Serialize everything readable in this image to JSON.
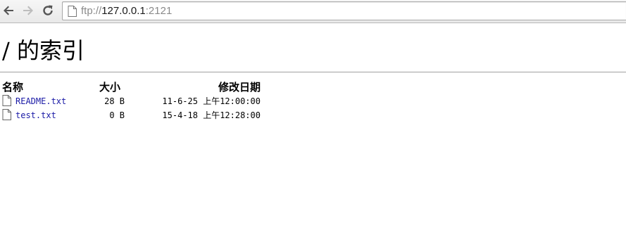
{
  "browser": {
    "url_scheme": "ftp://",
    "url_host": "127.0.0.1",
    "url_port": ":2121"
  },
  "page": {
    "title": "/ 的索引",
    "columns": {
      "name": "名称",
      "size": "大小",
      "date": "修改日期"
    },
    "files": [
      {
        "name": "README.txt",
        "size": "28 B",
        "date": "11-6-25 上午12:00:00",
        "icon": "file-icon"
      },
      {
        "name": "test.txt",
        "size": "0 B",
        "date": "15-4-18 上午12:28:00",
        "icon": "file-icon"
      }
    ]
  },
  "colors": {
    "link": "#1a1aa6",
    "text": "#000000",
    "rule": "#a0a0a0"
  }
}
